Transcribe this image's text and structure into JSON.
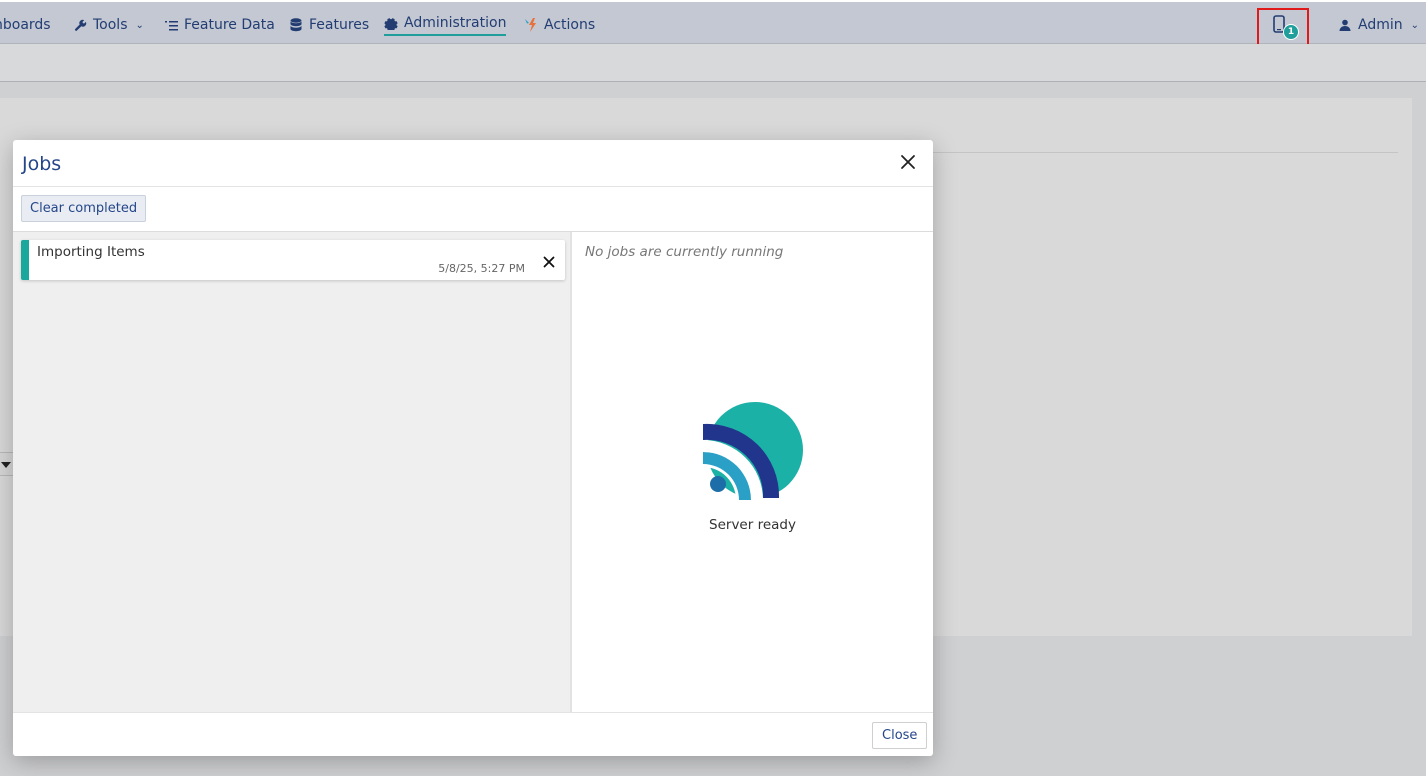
{
  "nav": {
    "items": [
      {
        "label": "nboards",
        "icon": "dashboards-icon"
      },
      {
        "label": "Tools",
        "icon": "wrench-icon",
        "dropdown": true
      },
      {
        "label": "Feature Data",
        "icon": "list-icon"
      },
      {
        "label": "Features",
        "icon": "database-icon"
      },
      {
        "label": "Administration",
        "icon": "gear-icon",
        "active": true
      },
      {
        "label": "Actions",
        "icon": "actions-icon"
      }
    ],
    "notifications": {
      "count": "1",
      "icon": "mobile-device-icon"
    },
    "user": {
      "label": "Admin",
      "icon": "user-icon"
    }
  },
  "modal": {
    "title": "Jobs",
    "clear_label": "Clear completed",
    "jobs": [
      {
        "name": "Importing Items",
        "time": "5/8/25, 5:27 PM"
      }
    ],
    "empty_message": "No jobs are currently running",
    "server_status": "Server ready",
    "close_label": "Close"
  },
  "colors": {
    "accent": "#1f9e9b",
    "nav_text": "#233d73",
    "highlight_border": "#e01a1a",
    "logo_teal": "#1cb1a6",
    "logo_navy": "#22358c",
    "logo_blue": "#2aa0c7"
  }
}
